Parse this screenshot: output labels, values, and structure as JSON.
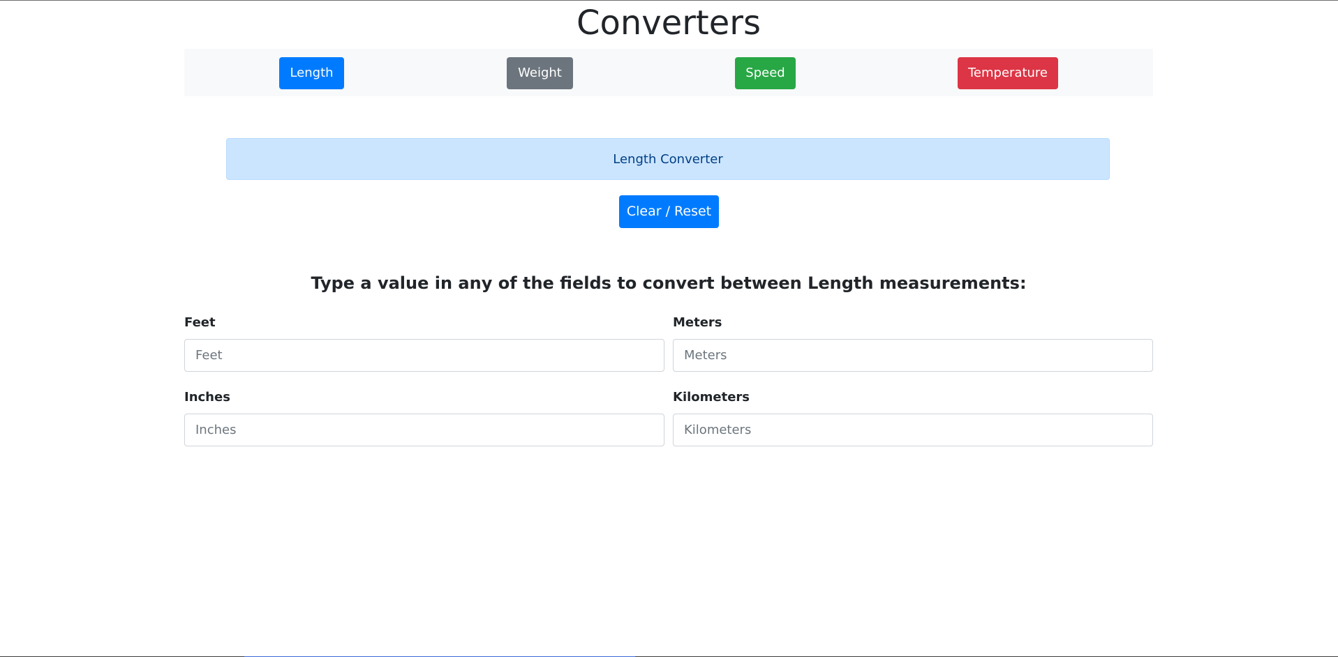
{
  "page": {
    "title": "Converters"
  },
  "nav": {
    "buttons": [
      {
        "label": "Length",
        "color": "#007bff"
      },
      {
        "label": "Weight",
        "color": "#6c757d"
      },
      {
        "label": "Speed",
        "color": "#28a745"
      },
      {
        "label": "Temperature",
        "color": "#dc3545"
      }
    ]
  },
  "converter": {
    "heading": "Length Converter",
    "reset_label": "Clear / Reset",
    "instructions": "Type a value in any of the fields to convert between Length measurements:",
    "fields": [
      {
        "label": "Feet",
        "placeholder": "Feet",
        "value": ""
      },
      {
        "label": "Meters",
        "placeholder": "Meters",
        "value": ""
      },
      {
        "label": "Inches",
        "placeholder": "Inches",
        "value": ""
      },
      {
        "label": "Kilometers",
        "placeholder": "Kilometers",
        "value": ""
      }
    ]
  },
  "colors": {
    "primary": "#007bff",
    "secondary": "#6c757d",
    "success": "#28a745",
    "danger": "#dc3545",
    "info_bg": "#cce5ff",
    "info_text": "#004085"
  }
}
